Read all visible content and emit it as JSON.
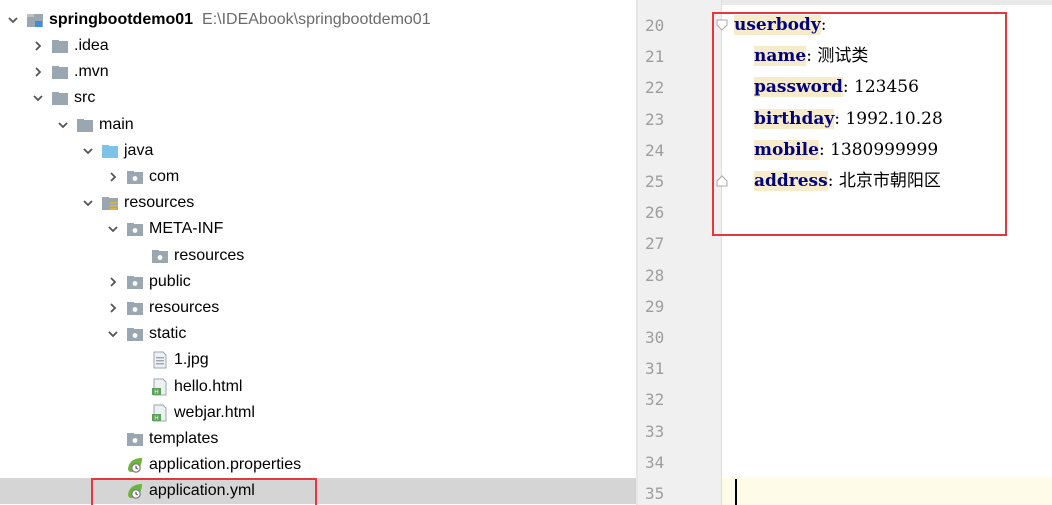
{
  "project_tree": {
    "root": {
      "name": "springbootdemo01",
      "path": "E:\\IDEAbook\\springbootdemo01"
    },
    "items": [
      {
        "label": ".idea",
        "depth": 1,
        "expanded": false,
        "icon": "folder-icon"
      },
      {
        "label": ".mvn",
        "depth": 1,
        "expanded": false,
        "icon": "folder-icon"
      },
      {
        "label": "src",
        "depth": 1,
        "expanded": true,
        "icon": "folder-icon"
      },
      {
        "label": "main",
        "depth": 2,
        "expanded": true,
        "icon": "folder-icon"
      },
      {
        "label": "java",
        "depth": 3,
        "expanded": true,
        "icon": "source-folder-icon"
      },
      {
        "label": "com",
        "depth": 4,
        "expanded": false,
        "icon": "package-icon"
      },
      {
        "label": "resources",
        "depth": 3,
        "expanded": true,
        "icon": "resources-folder-icon"
      },
      {
        "label": "META-INF",
        "depth": 4,
        "expanded": true,
        "icon": "package-icon"
      },
      {
        "label": "resources",
        "depth": 5,
        "expanded": null,
        "icon": "package-icon"
      },
      {
        "label": "public",
        "depth": 4,
        "expanded": false,
        "icon": "package-icon"
      },
      {
        "label": "resources",
        "depth": 4,
        "expanded": false,
        "icon": "package-icon"
      },
      {
        "label": "static",
        "depth": 4,
        "expanded": true,
        "icon": "package-icon"
      },
      {
        "label": "1.jpg",
        "depth": 5,
        "expanded": null,
        "icon": "image-file-icon"
      },
      {
        "label": "hello.html",
        "depth": 5,
        "expanded": null,
        "icon": "html-file-icon"
      },
      {
        "label": "webjar.html",
        "depth": 5,
        "expanded": null,
        "icon": "html-file-icon"
      },
      {
        "label": "templates",
        "depth": 4,
        "expanded": null,
        "icon": "package-icon"
      },
      {
        "label": "application.properties",
        "depth": 4,
        "expanded": null,
        "icon": "spring-config-icon"
      },
      {
        "label": "application.yml",
        "depth": 4,
        "expanded": null,
        "icon": "spring-config-icon",
        "selected": true
      }
    ]
  },
  "editor": {
    "line_numbers": [
      "20",
      "21",
      "22",
      "23",
      "24",
      "25",
      "26",
      "27",
      "28",
      "29",
      "30",
      "31",
      "32",
      "33",
      "34",
      "35"
    ],
    "lines": [
      {
        "indent": 0,
        "key": "userbody",
        "value": ""
      },
      {
        "indent": 1,
        "key": "name",
        "value": "测试类"
      },
      {
        "indent": 1,
        "key": "password",
        "value": "123456"
      },
      {
        "indent": 1,
        "key": "birthday",
        "value": "1992.10.28"
      },
      {
        "indent": 1,
        "key": "mobile",
        "value": "1380999999"
      },
      {
        "indent": 1,
        "key": "address",
        "value": "北京市朝阳区"
      }
    ]
  },
  "colors": {
    "highlight_box": "#e0393e",
    "yaml_key": "#000080",
    "key_background": "#f6eccb",
    "selected_row": "#d5d5d5"
  }
}
